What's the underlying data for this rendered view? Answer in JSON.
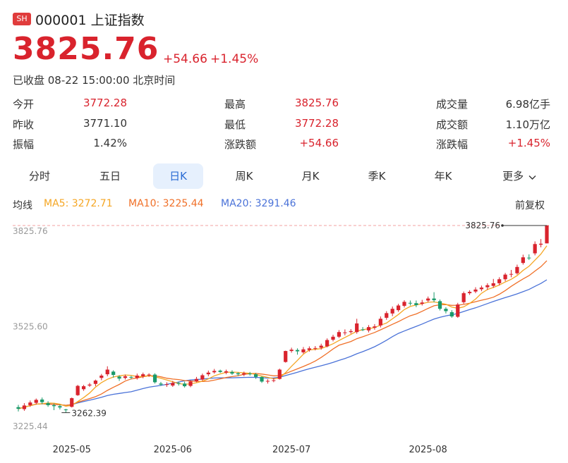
{
  "header": {
    "market_badge": "SH",
    "title": "000001 上证指数",
    "price": "3825.76",
    "change": "+54.66",
    "change_pct": "+1.45%",
    "status": "已收盘 08-22 15:00:00 北京时间"
  },
  "stats": [
    [
      {
        "label": "今开",
        "value": "3772.28",
        "color": "red"
      },
      {
        "label": "最高",
        "value": "3825.76",
        "color": "red"
      },
      {
        "label": "成交量",
        "value": "6.98亿手",
        "color": "dark"
      }
    ],
    [
      {
        "label": "昨收",
        "value": "3771.10",
        "color": "dark"
      },
      {
        "label": "最低",
        "value": "3772.28",
        "color": "red"
      },
      {
        "label": "成交额",
        "value": "1.10万亿",
        "color": "dark"
      }
    ],
    [
      {
        "label": "振幅",
        "value": "1.42%",
        "color": "dark"
      },
      {
        "label": "涨跌额",
        "value": "+54.66",
        "color": "red"
      },
      {
        "label": "涨跌幅",
        "value": "+1.45%",
        "color": "red"
      }
    ]
  ],
  "tabs": [
    "分时",
    "五日",
    "日K",
    "周K",
    "月K",
    "季K",
    "年K",
    "更多"
  ],
  "active_tab": "日K",
  "indicators": {
    "label": "均线",
    "ma5": "MA5: 3272.71",
    "ma10": "MA10: 3225.44",
    "ma20": "MA20: 3291.46",
    "adjust": "前复权"
  },
  "colors": {
    "up": "#d9232d",
    "down": "#1a9a6a",
    "ma5": "#f5a623",
    "ma10": "#f07028",
    "ma20": "#4a72d8",
    "accent": "#2b6cd4"
  },
  "chart_data": {
    "type": "candlestick",
    "y_labels": [
      "3825.76",
      "3525.60",
      "3225.44"
    ],
    "ylim": [
      3225.44,
      3825.76
    ],
    "x_labels": [
      {
        "label": "2025-05",
        "index": 9
      },
      {
        "label": "2025-06",
        "index": 26
      },
      {
        "label": "2025-07",
        "index": 46
      },
      {
        "label": "2025-08",
        "index": 69
      }
    ],
    "high_marker": "3825.76",
    "low_marker": "3262.39",
    "candles": [
      [
        3279,
        3274,
        3286,
        3266
      ],
      [
        3273,
        3284,
        3291,
        3268
      ],
      [
        3285,
        3293,
        3299,
        3280
      ],
      [
        3292,
        3301,
        3305,
        3287
      ],
      [
        3302,
        3294,
        3308,
        3288
      ],
      [
        3291,
        3285,
        3297,
        3280
      ],
      [
        3285,
        3282,
        3290,
        3270
      ],
      [
        3282,
        3278,
        3287,
        3272
      ],
      [
        3272,
        3270,
        3274,
        3262
      ],
      [
        3280,
        3306,
        3308,
        3278
      ],
      [
        3315,
        3343,
        3346,
        3313
      ],
      [
        3333,
        3342,
        3346,
        3328
      ],
      [
        3344,
        3347,
        3352,
        3340
      ],
      [
        3349,
        3359,
        3362,
        3342
      ],
      [
        3367,
        3374,
        3379,
        3360
      ],
      [
        3378,
        3392,
        3402,
        3372
      ],
      [
        3386,
        3376,
        3390,
        3368
      ],
      [
        3371,
        3365,
        3375,
        3358
      ],
      [
        3367,
        3372,
        3377,
        3362
      ],
      [
        3370,
        3369,
        3373,
        3364
      ],
      [
        3367,
        3374,
        3380,
        3362
      ],
      [
        3372,
        3378,
        3383,
        3366
      ],
      [
        3376,
        3377,
        3381,
        3370
      ],
      [
        3377,
        3354,
        3381,
        3350
      ],
      [
        3350,
        3347,
        3355,
        3343
      ],
      [
        3346,
        3348,
        3354,
        3340
      ],
      [
        3344,
        3352,
        3358,
        3340
      ],
      [
        3351,
        3349,
        3356,
        3344
      ],
      [
        3350,
        3342,
        3356,
        3338
      ],
      [
        3343,
        3356,
        3360,
        3339
      ],
      [
        3357,
        3364,
        3370,
        3354
      ],
      [
        3362,
        3375,
        3380,
        3358
      ],
      [
        3378,
        3383,
        3389,
        3372
      ],
      [
        3384,
        3388,
        3394,
        3380
      ],
      [
        3389,
        3385,
        3392,
        3382
      ],
      [
        3383,
        3387,
        3392,
        3378
      ],
      [
        3385,
        3380,
        3390,
        3376
      ],
      [
        3381,
        3378,
        3384,
        3373
      ],
      [
        3377,
        3381,
        3386,
        3372
      ],
      [
        3380,
        3378,
        3385,
        3374
      ],
      [
        3378,
        3370,
        3382,
        3364
      ],
      [
        3370,
        3356,
        3372,
        3352
      ],
      [
        3356,
        3358,
        3363,
        3350
      ],
      [
        3359,
        3360,
        3366,
        3354
      ],
      [
        3364,
        3392,
        3395,
        3362
      ],
      [
        3415,
        3448,
        3449,
        3413
      ],
      [
        3448,
        3452,
        3458,
        3443
      ],
      [
        3451,
        3447,
        3456,
        3437
      ],
      [
        3444,
        3453,
        3460,
        3440
      ],
      [
        3451,
        3456,
        3462,
        3446
      ],
      [
        3455,
        3457,
        3463,
        3450
      ],
      [
        3458,
        3464,
        3470,
        3452
      ],
      [
        3462,
        3481,
        3486,
        3459
      ],
      [
        3482,
        3491,
        3497,
        3477
      ],
      [
        3491,
        3505,
        3511,
        3487
      ],
      [
        3504,
        3504,
        3513,
        3495
      ],
      [
        3505,
        3508,
        3514,
        3500
      ],
      [
        3505,
        3531,
        3545,
        3500
      ],
      [
        3513,
        3512,
        3520,
        3508
      ],
      [
        3510,
        3520,
        3526,
        3504
      ],
      [
        3518,
        3522,
        3529,
        3512
      ],
      [
        3525,
        3545,
        3552,
        3519
      ],
      [
        3548,
        3562,
        3568,
        3542
      ],
      [
        3561,
        3575,
        3582,
        3553
      ],
      [
        3571,
        3585,
        3590,
        3566
      ],
      [
        3584,
        3596,
        3601,
        3579
      ],
      [
        3593,
        3592,
        3600,
        3585
      ],
      [
        3592,
        3586,
        3600,
        3580
      ],
      [
        3590,
        3594,
        3602,
        3585
      ],
      [
        3600,
        3606,
        3612,
        3595
      ],
      [
        3606,
        3601,
        3625,
        3595
      ],
      [
        3598,
        3575,
        3603,
        3570
      ],
      [
        3575,
        3568,
        3580,
        3561
      ],
      [
        3565,
        3552,
        3571,
        3548
      ],
      [
        3551,
        3588,
        3593,
        3548
      ],
      [
        3595,
        3622,
        3627,
        3590
      ],
      [
        3622,
        3626,
        3631,
        3617
      ],
      [
        3627,
        3633,
        3640,
        3622
      ],
      [
        3634,
        3639,
        3645,
        3628
      ],
      [
        3640,
        3646,
        3652,
        3632
      ],
      [
        3644,
        3652,
        3665,
        3638
      ],
      [
        3652,
        3664,
        3670,
        3646
      ],
      [
        3664,
        3678,
        3683,
        3658
      ],
      [
        3678,
        3680,
        3692,
        3670
      ],
      [
        3682,
        3701,
        3708,
        3678
      ],
      [
        3713,
        3730,
        3738,
        3708
      ],
      [
        3729,
        3727,
        3739,
        3722
      ],
      [
        3742,
        3770,
        3778,
        3736
      ],
      [
        3768,
        3771,
        3785,
        3760
      ],
      [
        3772,
        3826,
        3826,
        3772
      ]
    ]
  }
}
